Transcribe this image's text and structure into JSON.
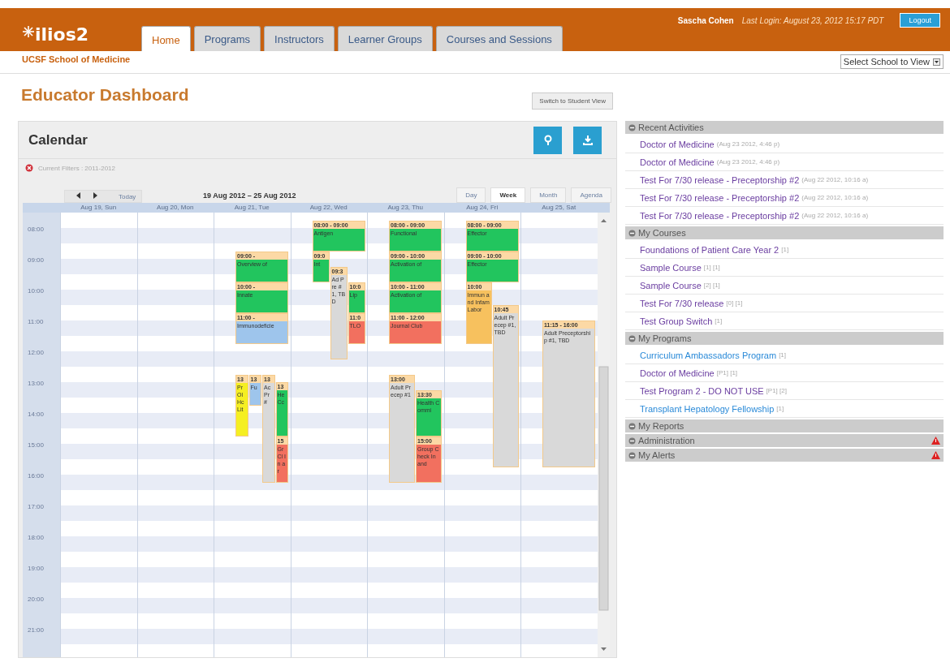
{
  "app": {
    "logo": "ilios2",
    "user": "Sascha Cohen",
    "last_login": "Last Login: August 23, 2012 15:17 PDT",
    "logout": "Logout",
    "school": "UCSF School of Medicine",
    "school_select": "Select School to View"
  },
  "tabs": [
    {
      "label": "Home",
      "selected": true
    },
    {
      "label": "Programs",
      "selected": false
    },
    {
      "label": "Instructors",
      "selected": false
    },
    {
      "label": "Learner Groups",
      "selected": false
    },
    {
      "label": "Courses and Sessions",
      "selected": false
    }
  ],
  "page_title": "Educator Dashboard",
  "switch_button": "Switch to Student View",
  "calendar": {
    "title": "Calendar",
    "filters": "Current Filters : 2011-2012",
    "today": "Today",
    "range": "19 Aug 2012 – 25 Aug 2012",
    "views": [
      {
        "label": "Day",
        "selected": false
      },
      {
        "label": "Week",
        "selected": true
      },
      {
        "label": "Month",
        "selected": false
      },
      {
        "label": "Agenda",
        "selected": false
      }
    ],
    "hours": [
      "08:00",
      "09:00",
      "10:00",
      "11:00",
      "12:00",
      "13:00",
      "14:00",
      "15:00",
      "16:00",
      "17:00",
      "18:00",
      "19:00",
      "20:00",
      "21:00"
    ],
    "days": [
      {
        "label": "Aug 19, Sun"
      },
      {
        "label": "Aug 20, Mon"
      },
      {
        "label": "Aug 21, Tue",
        "events": [
          {
            "time": "09:00 -",
            "title": "Overview of",
            "color": "#22c55e"
          },
          {
            "time": "10:00 -",
            "title": "Innate",
            "color": "#22c55e"
          },
          {
            "time": "11:00 -",
            "title": "Immunodeficie",
            "color": "#9ec5ec"
          },
          {
            "time": "13",
            "title": "Pr Ol Hc Lit",
            "color": "#f5ef22"
          },
          {
            "time": "13",
            "title": "Fu",
            "color": "#9ec5ec"
          },
          {
            "time": "13",
            "title": "Ac Pr #",
            "color": "#d9d9d9"
          },
          {
            "time": "13",
            "title": "He Cc",
            "color": "#22c55e"
          },
          {
            "time": "15",
            "title": "Gr Cl In ar",
            "color": "#f2705f"
          }
        ]
      },
      {
        "label": "Aug 22, Wed",
        "events": [
          {
            "time": "08:00 - 09:00",
            "title": "Antigen",
            "color": "#22c55e"
          },
          {
            "time": "09:0",
            "title": "Int",
            "color": "#22c55e"
          },
          {
            "time": "09:3",
            "title": "Ad Pre #1, TBD",
            "color": "#d9d9d9"
          },
          {
            "time": "10:0",
            "title": "Lip",
            "color": "#22c55e"
          },
          {
            "time": "11:0",
            "title": "TLO",
            "color": "#f2705f"
          }
        ]
      },
      {
        "label": "Aug 23, Thu",
        "events": [
          {
            "time": "08:00 - 09:00",
            "title": "Functional",
            "color": "#22c55e"
          },
          {
            "time": "09:00 - 10:00",
            "title": "Activation of",
            "color": "#22c55e"
          },
          {
            "time": "10:00 - 11:00",
            "title": "Activation of",
            "color": "#22c55e"
          },
          {
            "time": "11:00 - 12:00",
            "title": "Journal Club",
            "color": "#f2705f"
          },
          {
            "time": "13:00",
            "title": "Adult Precep #1",
            "color": "#d9d9d9"
          },
          {
            "time": "13:30",
            "title": "Health Commi",
            "color": "#22c55e"
          },
          {
            "time": "15:00",
            "title": "Group Check In and",
            "color": "#f2705f"
          }
        ]
      },
      {
        "label": "Aug 24, Fri",
        "events": [
          {
            "time": "08:00 - 09:00",
            "title": "Effector",
            "color": "#22c55e"
          },
          {
            "time": "09:00 - 10:00",
            "title": "Effector",
            "color": "#22c55e"
          },
          {
            "time": "10:00",
            "title": "Immun and Infam Labor",
            "color": "#f7c15e"
          },
          {
            "time": "10:45",
            "title": "Adult Precep #1, TBD",
            "color": "#d9d9d9"
          }
        ]
      },
      {
        "label": "Aug 25, Sat",
        "events": [
          {
            "time": "11:15 - 16:00",
            "title": "Adult Preceptorship #1, TBD",
            "color": "#d9d9d9"
          }
        ]
      }
    ]
  },
  "sections": [
    {
      "title": "Recent Activities",
      "alert": false,
      "items": [
        {
          "label": "Doctor of Medicine",
          "meta": "(Aug 23 2012, 4:46 p)",
          "visited": true
        },
        {
          "label": "Doctor of Medicine",
          "meta": "(Aug 23 2012, 4:46 p)",
          "visited": true
        },
        {
          "label": "Test For 7/30 release - Preceptorship #2",
          "meta": "(Aug 22 2012, 10:16 a)",
          "visited": true
        },
        {
          "label": "Test For 7/30 release - Preceptorship #2",
          "meta": "(Aug 22 2012, 10:16 a)",
          "visited": true
        },
        {
          "label": "Test For 7/30 release - Preceptorship #2",
          "meta": "(Aug 22 2012, 10:16 a)",
          "visited": true
        }
      ]
    },
    {
      "title": "My Courses",
      "alert": false,
      "items": [
        {
          "label": "Foundations of Patient Care Year 2",
          "meta": "[1]",
          "visited": true
        },
        {
          "label": "Sample Course",
          "meta": "[1] [1]",
          "visited": true
        },
        {
          "label": "Sample Course",
          "meta": "[2] [1]",
          "visited": true
        },
        {
          "label": "Test For 7/30 release",
          "meta": "[0] [1]",
          "visited": true
        },
        {
          "label": "Test Group Switch",
          "meta": "[1]",
          "visited": true
        }
      ]
    },
    {
      "title": "My Programs",
      "alert": false,
      "items": [
        {
          "label": "Curriculum Ambassadors Program",
          "meta": "[1]",
          "visited": false
        },
        {
          "label": "Doctor of Medicine",
          "meta": "[P1] [1]",
          "visited": true
        },
        {
          "label": "Test Program 2 - DO NOT USE",
          "meta": "[P1] [2]",
          "visited": true
        },
        {
          "label": "Transplant Hepatology Fellowship",
          "meta": "[1]",
          "visited": false
        }
      ]
    },
    {
      "title": "My Reports",
      "alert": false
    },
    {
      "title": "Administration",
      "alert": true
    },
    {
      "title": "My Alerts",
      "alert": true
    }
  ]
}
